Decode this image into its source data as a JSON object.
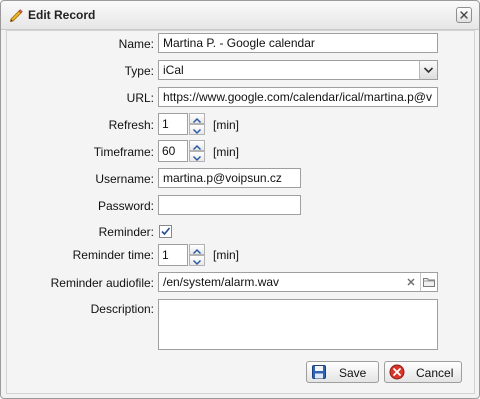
{
  "dialog": {
    "title": "Edit Record"
  },
  "form": {
    "name_label": "Name:",
    "name_value": "Martina P. - Google calendar",
    "type_label": "Type:",
    "type_value": "iCal",
    "url_label": "URL:",
    "url_value": "https://www.google.com/calendar/ical/martina.p@v",
    "refresh_label": "Refresh:",
    "refresh_value": "1",
    "refresh_unit": "[min]",
    "timeframe_label": "Timeframe:",
    "timeframe_value": "60",
    "timeframe_unit": "[min]",
    "username_label": "Username:",
    "username_value": "martina.p@voipsun.cz",
    "password_label": "Password:",
    "password_value": "",
    "reminder_label": "Reminder:",
    "reminder_checked": true,
    "reminder_time_label": "Reminder time:",
    "reminder_time_value": "1",
    "reminder_time_unit": "[min]",
    "audiofile_label": "Reminder audiofile:",
    "audiofile_value": "/en/system/alarm.wav",
    "description_label": "Description:",
    "description_value": ""
  },
  "buttons": {
    "save_label": "Save",
    "cancel_label": "Cancel"
  },
  "icons": {
    "title": "pencil-icon",
    "close": "close-icon",
    "save": "floppy-disk-icon",
    "cancel": "cancel-icon",
    "clear": "clear-icon",
    "browse": "folder-icon"
  }
}
